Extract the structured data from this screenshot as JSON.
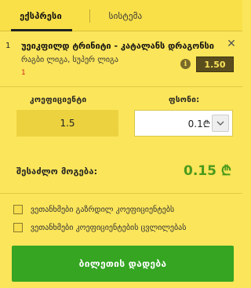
{
  "tabs": [
    {
      "label": "ექსპრესი",
      "active": true
    },
    {
      "label": "სისტემა",
      "active": false
    }
  ],
  "bet": {
    "number": "1",
    "title": "უეიკფილდ ტრინიტი - კატალანს დრაგონსი",
    "subtitle": "რაგბი ლიგა, სუპერ ლიგა",
    "selection": "1",
    "odds": "1.50"
  },
  "inputs": {
    "odds_label": "კოეფიციენტი",
    "odds_value": "1.5",
    "stake_label": "ფსონი:",
    "stake_value": "0.1₾"
  },
  "possible_win": {
    "label": "შესაძლო მოგება:",
    "value": "0.15 ₾"
  },
  "options": [
    {
      "label": "ვეთანხმები გაზრდილ კოეფიციენტებს",
      "checked": false
    },
    {
      "label": "ვეთანხმები კოეფიციენტების ცვლილებას",
      "checked": false
    }
  ],
  "place_button": "ბილეთის დადება",
  "colors": {
    "background": "#fbe55a",
    "accent_green": "#35a522",
    "win_green": "#4a9a1c",
    "odds_box": "#5a4d1d",
    "selection_red": "#d2281e"
  }
}
